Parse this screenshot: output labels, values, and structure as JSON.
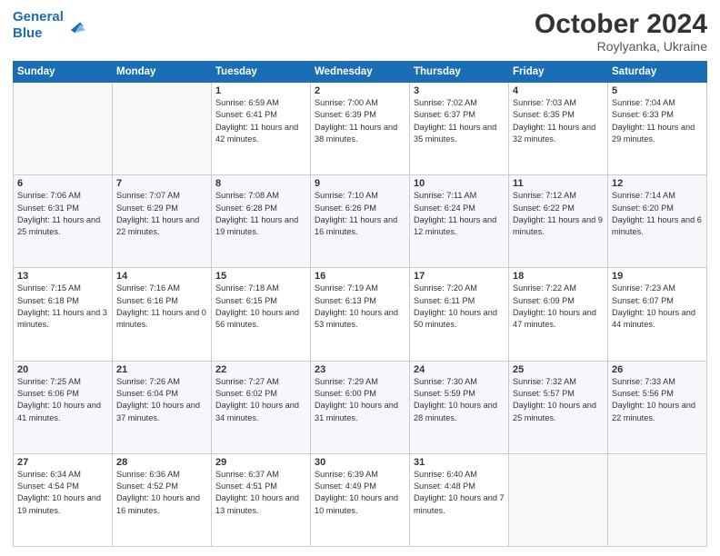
{
  "logo": {
    "line1": "General",
    "line2": "Blue"
  },
  "title": "October 2024",
  "subtitle": "Roylyanka, Ukraine",
  "header_days": [
    "Sunday",
    "Monday",
    "Tuesday",
    "Wednesday",
    "Thursday",
    "Friday",
    "Saturday"
  ],
  "weeks": [
    [
      {
        "day": "",
        "sunrise": "",
        "sunset": "",
        "daylight": ""
      },
      {
        "day": "",
        "sunrise": "",
        "sunset": "",
        "daylight": ""
      },
      {
        "day": "1",
        "sunrise": "Sunrise: 6:59 AM",
        "sunset": "Sunset: 6:41 PM",
        "daylight": "Daylight: 11 hours and 42 minutes."
      },
      {
        "day": "2",
        "sunrise": "Sunrise: 7:00 AM",
        "sunset": "Sunset: 6:39 PM",
        "daylight": "Daylight: 11 hours and 38 minutes."
      },
      {
        "day": "3",
        "sunrise": "Sunrise: 7:02 AM",
        "sunset": "Sunset: 6:37 PM",
        "daylight": "Daylight: 11 hours and 35 minutes."
      },
      {
        "day": "4",
        "sunrise": "Sunrise: 7:03 AM",
        "sunset": "Sunset: 6:35 PM",
        "daylight": "Daylight: 11 hours and 32 minutes."
      },
      {
        "day": "5",
        "sunrise": "Sunrise: 7:04 AM",
        "sunset": "Sunset: 6:33 PM",
        "daylight": "Daylight: 11 hours and 29 minutes."
      }
    ],
    [
      {
        "day": "6",
        "sunrise": "Sunrise: 7:06 AM",
        "sunset": "Sunset: 6:31 PM",
        "daylight": "Daylight: 11 hours and 25 minutes."
      },
      {
        "day": "7",
        "sunrise": "Sunrise: 7:07 AM",
        "sunset": "Sunset: 6:29 PM",
        "daylight": "Daylight: 11 hours and 22 minutes."
      },
      {
        "day": "8",
        "sunrise": "Sunrise: 7:08 AM",
        "sunset": "Sunset: 6:28 PM",
        "daylight": "Daylight: 11 hours and 19 minutes."
      },
      {
        "day": "9",
        "sunrise": "Sunrise: 7:10 AM",
        "sunset": "Sunset: 6:26 PM",
        "daylight": "Daylight: 11 hours and 16 minutes."
      },
      {
        "day": "10",
        "sunrise": "Sunrise: 7:11 AM",
        "sunset": "Sunset: 6:24 PM",
        "daylight": "Daylight: 11 hours and 12 minutes."
      },
      {
        "day": "11",
        "sunrise": "Sunrise: 7:12 AM",
        "sunset": "Sunset: 6:22 PM",
        "daylight": "Daylight: 11 hours and 9 minutes."
      },
      {
        "day": "12",
        "sunrise": "Sunrise: 7:14 AM",
        "sunset": "Sunset: 6:20 PM",
        "daylight": "Daylight: 11 hours and 6 minutes."
      }
    ],
    [
      {
        "day": "13",
        "sunrise": "Sunrise: 7:15 AM",
        "sunset": "Sunset: 6:18 PM",
        "daylight": "Daylight: 11 hours and 3 minutes."
      },
      {
        "day": "14",
        "sunrise": "Sunrise: 7:16 AM",
        "sunset": "Sunset: 6:16 PM",
        "daylight": "Daylight: 11 hours and 0 minutes."
      },
      {
        "day": "15",
        "sunrise": "Sunrise: 7:18 AM",
        "sunset": "Sunset: 6:15 PM",
        "daylight": "Daylight: 10 hours and 56 minutes."
      },
      {
        "day": "16",
        "sunrise": "Sunrise: 7:19 AM",
        "sunset": "Sunset: 6:13 PM",
        "daylight": "Daylight: 10 hours and 53 minutes."
      },
      {
        "day": "17",
        "sunrise": "Sunrise: 7:20 AM",
        "sunset": "Sunset: 6:11 PM",
        "daylight": "Daylight: 10 hours and 50 minutes."
      },
      {
        "day": "18",
        "sunrise": "Sunrise: 7:22 AM",
        "sunset": "Sunset: 6:09 PM",
        "daylight": "Daylight: 10 hours and 47 minutes."
      },
      {
        "day": "19",
        "sunrise": "Sunrise: 7:23 AM",
        "sunset": "Sunset: 6:07 PM",
        "daylight": "Daylight: 10 hours and 44 minutes."
      }
    ],
    [
      {
        "day": "20",
        "sunrise": "Sunrise: 7:25 AM",
        "sunset": "Sunset: 6:06 PM",
        "daylight": "Daylight: 10 hours and 41 minutes."
      },
      {
        "day": "21",
        "sunrise": "Sunrise: 7:26 AM",
        "sunset": "Sunset: 6:04 PM",
        "daylight": "Daylight: 10 hours and 37 minutes."
      },
      {
        "day": "22",
        "sunrise": "Sunrise: 7:27 AM",
        "sunset": "Sunset: 6:02 PM",
        "daylight": "Daylight: 10 hours and 34 minutes."
      },
      {
        "day": "23",
        "sunrise": "Sunrise: 7:29 AM",
        "sunset": "Sunset: 6:00 PM",
        "daylight": "Daylight: 10 hours and 31 minutes."
      },
      {
        "day": "24",
        "sunrise": "Sunrise: 7:30 AM",
        "sunset": "Sunset: 5:59 PM",
        "daylight": "Daylight: 10 hours and 28 minutes."
      },
      {
        "day": "25",
        "sunrise": "Sunrise: 7:32 AM",
        "sunset": "Sunset: 5:57 PM",
        "daylight": "Daylight: 10 hours and 25 minutes."
      },
      {
        "day": "26",
        "sunrise": "Sunrise: 7:33 AM",
        "sunset": "Sunset: 5:56 PM",
        "daylight": "Daylight: 10 hours and 22 minutes."
      }
    ],
    [
      {
        "day": "27",
        "sunrise": "Sunrise: 6:34 AM",
        "sunset": "Sunset: 4:54 PM",
        "daylight": "Daylight: 10 hours and 19 minutes."
      },
      {
        "day": "28",
        "sunrise": "Sunrise: 6:36 AM",
        "sunset": "Sunset: 4:52 PM",
        "daylight": "Daylight: 10 hours and 16 minutes."
      },
      {
        "day": "29",
        "sunrise": "Sunrise: 6:37 AM",
        "sunset": "Sunset: 4:51 PM",
        "daylight": "Daylight: 10 hours and 13 minutes."
      },
      {
        "day": "30",
        "sunrise": "Sunrise: 6:39 AM",
        "sunset": "Sunset: 4:49 PM",
        "daylight": "Daylight: 10 hours and 10 minutes."
      },
      {
        "day": "31",
        "sunrise": "Sunrise: 6:40 AM",
        "sunset": "Sunset: 4:48 PM",
        "daylight": "Daylight: 10 hours and 7 minutes."
      },
      {
        "day": "",
        "sunrise": "",
        "sunset": "",
        "daylight": ""
      },
      {
        "day": "",
        "sunrise": "",
        "sunset": "",
        "daylight": ""
      }
    ]
  ]
}
